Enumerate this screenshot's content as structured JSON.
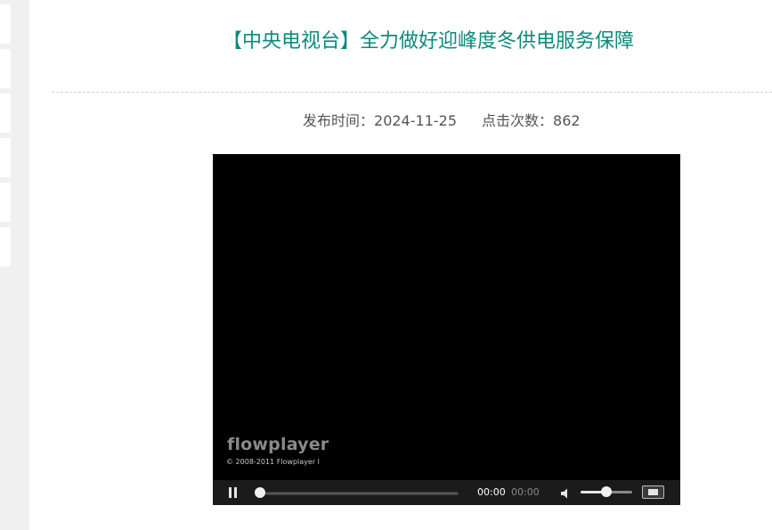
{
  "article": {
    "title": "【中央电视台】全力做好迎峰度冬供电服务保障",
    "publish_label": "发布时间：",
    "publish_date": "2024-11-25",
    "views_label": "点击次数：",
    "views": "862"
  },
  "player": {
    "logo": "flowplayer",
    "copyright": "© 2008-2011 Flowplayer l",
    "elapsed": "00:00",
    "total": "00:00",
    "progress": 0,
    "volume": 0.5,
    "icons": {
      "play_state": "pause-icon",
      "mute": "speaker-icon",
      "fullscreen": "fullscreen-icon"
    }
  },
  "colors": {
    "title": "#0c8a7c",
    "meta_text": "#555555",
    "player_bg": "#000000",
    "controls_bg": "#1b1b1b",
    "sidebar_bg": "#f0f0f0"
  }
}
